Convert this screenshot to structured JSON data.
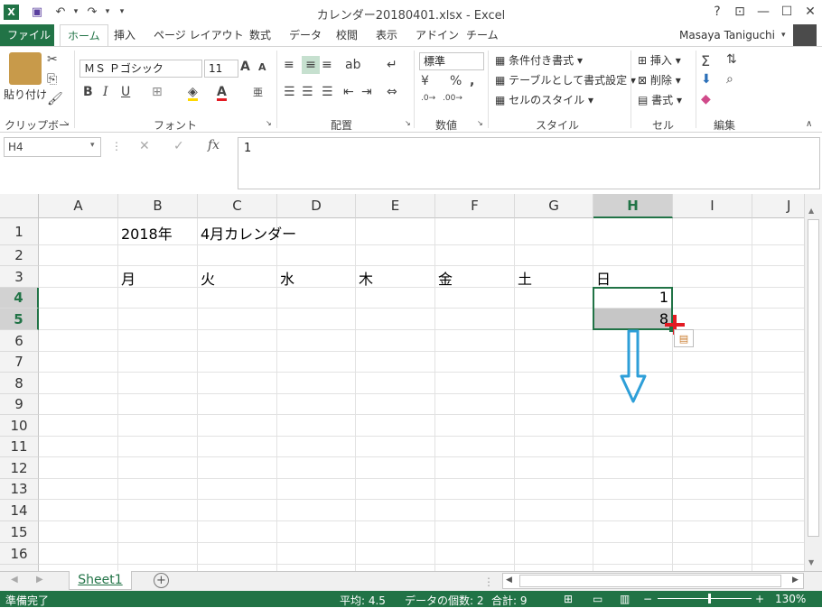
{
  "window": {
    "title": "カレンダー20180401.xlsx - Excel",
    "help": "?",
    "controls": [
      "⊡",
      "—",
      "☐",
      "✕"
    ]
  },
  "qat": {
    "excel_icon": "X",
    "save_icon": "💾",
    "undo": "↶",
    "redo": "↷",
    "customize": "▾"
  },
  "tabs": [
    {
      "label": "ファイル"
    },
    {
      "label": "ホーム"
    },
    {
      "label": "挿入"
    },
    {
      "label": "ページ レイアウト"
    },
    {
      "label": "数式"
    },
    {
      "label": "データ"
    },
    {
      "label": "校閲"
    },
    {
      "label": "表示"
    },
    {
      "label": "アドイン"
    },
    {
      "label": "チーム"
    }
  ],
  "user": {
    "name": "Masaya Taniguchi"
  },
  "ribbon": {
    "clipboard": {
      "paste": "貼り付け",
      "label": "クリップボード"
    },
    "font": {
      "name": "ＭＳ Ｐゴシック",
      "size": "11",
      "bold": "B",
      "italic": "I",
      "underline": "U",
      "grow": "A",
      "shrink": "A",
      "color_a": "A",
      "phonetic": "亜",
      "label": "フォント"
    },
    "alignment": {
      "label": "配置"
    },
    "number": {
      "format": "標準",
      "percent": "%",
      "comma": ",",
      "label": "数値"
    },
    "styles": {
      "conditional": "条件付き書式",
      "table": "テーブルとして書式設定",
      "cell": "セルのスタイル",
      "label": "スタイル"
    },
    "cells": {
      "insert": "挿入",
      "delete": "削除",
      "format": "書式",
      "label": "セル"
    },
    "editing": {
      "sum": "Σ",
      "label": "編集"
    }
  },
  "formula_bar": {
    "name_box": "H4",
    "cancel": "✕",
    "enter": "✓",
    "fx": "fx",
    "value": "1"
  },
  "columns": [
    "A",
    "B",
    "C",
    "D",
    "E",
    "F",
    "G",
    "H",
    "I",
    "J"
  ],
  "rows": [
    "1",
    "2",
    "3",
    "4",
    "5",
    "6",
    "7",
    "8",
    "9",
    "10",
    "11",
    "12",
    "13",
    "14",
    "15",
    "16"
  ],
  "cells": {
    "B1": "2018年",
    "C1": "4月カレンダー",
    "B3": "月",
    "C3": "火",
    "D3": "水",
    "E3": "木",
    "F3": "金",
    "G3": "土",
    "H3": "日",
    "H4": "1",
    "H5": "8"
  },
  "sheet_tabs": [
    {
      "label": "Sheet1"
    }
  ],
  "status": {
    "ready": "準備完了",
    "average": "平均: 4.5",
    "count": "データの個数: 2",
    "sum": "合計: 9",
    "zoom": "130%"
  },
  "colors": {
    "accent": "#217346",
    "fill_arrow": "#2e9fd8",
    "handle": "#e31b23"
  }
}
